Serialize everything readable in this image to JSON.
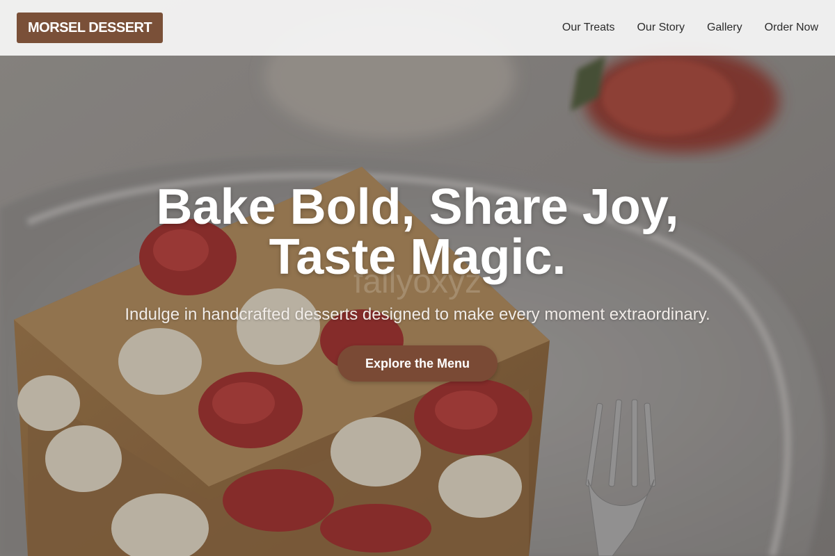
{
  "brand": {
    "name": "MORSEL DESSERT",
    "color": "#7a5038"
  },
  "nav": {
    "links": [
      {
        "label": "Our Treats"
      },
      {
        "label": "Our Story"
      },
      {
        "label": "Gallery"
      },
      {
        "label": "Order Now"
      }
    ]
  },
  "hero": {
    "title_line1": "Bake Bold, Share Joy,",
    "title_line2": "Taste Magic.",
    "subtitle": "Indulge in handcrafted desserts designed to make every moment extraordinary.",
    "cta_label": "Explore the Menu",
    "cta_color": "#7a4a35",
    "background_image": "strawberry-mille-feuille-photo",
    "watermark": "fallyoxyz"
  }
}
